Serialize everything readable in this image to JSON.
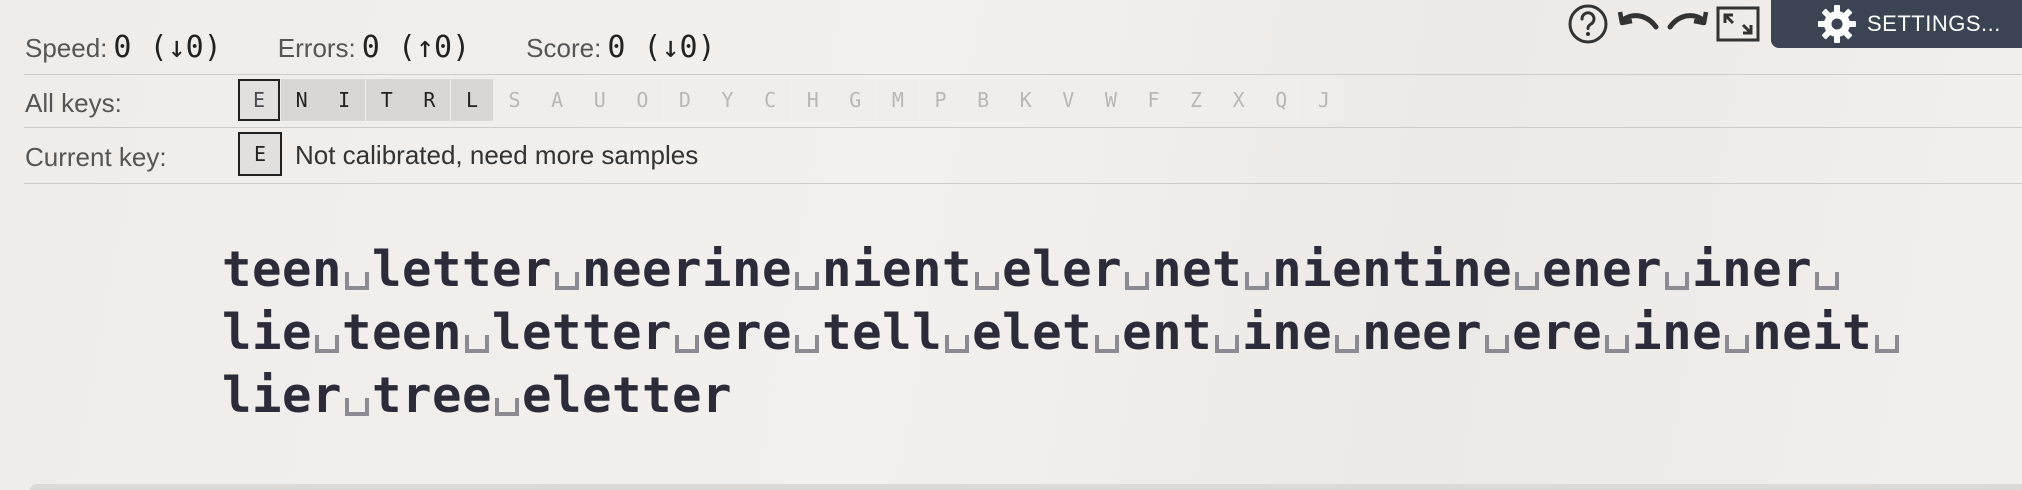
{
  "toolbar": {
    "help_icon": "help-icon",
    "undo_icon": "undo-icon",
    "redo_icon": "redo-icon",
    "fullscreen_icon": "fullscreen-icon",
    "settings_label": "SETTINGS..."
  },
  "stats": {
    "speed_label": "Speed:",
    "speed_value": "0 (↓0)",
    "errors_label": "Errors:",
    "errors_value": "0 (↑0)",
    "score_label": "Score:",
    "score_value": "0 (↓0)"
  },
  "all_keys": {
    "label": "All keys:",
    "keys": [
      {
        "k": "E",
        "state": "selected"
      },
      {
        "k": "N",
        "state": "on"
      },
      {
        "k": "I",
        "state": "on"
      },
      {
        "k": "T",
        "state": "on"
      },
      {
        "k": "R",
        "state": "on"
      },
      {
        "k": "L",
        "state": "on"
      },
      {
        "k": "S",
        "state": "off"
      },
      {
        "k": "A",
        "state": "off"
      },
      {
        "k": "U",
        "state": "off"
      },
      {
        "k": "O",
        "state": "off"
      },
      {
        "k": "D",
        "state": "off"
      },
      {
        "k": "Y",
        "state": "off"
      },
      {
        "k": "C",
        "state": "off"
      },
      {
        "k": "H",
        "state": "off"
      },
      {
        "k": "G",
        "state": "off"
      },
      {
        "k": "M",
        "state": "off"
      },
      {
        "k": "P",
        "state": "off"
      },
      {
        "k": "B",
        "state": "off"
      },
      {
        "k": "K",
        "state": "off"
      },
      {
        "k": "V",
        "state": "off"
      },
      {
        "k": "W",
        "state": "off"
      },
      {
        "k": "F",
        "state": "off"
      },
      {
        "k": "Z",
        "state": "off"
      },
      {
        "k": "X",
        "state": "off"
      },
      {
        "k": "Q",
        "state": "off"
      },
      {
        "k": "J",
        "state": "off"
      }
    ]
  },
  "current_key": {
    "label": "Current key:",
    "key": "E",
    "status": "Not calibrated, need more samples"
  },
  "lesson": {
    "lines": [
      [
        "teen",
        "letter",
        "neerine",
        "nient",
        "eler",
        "net",
        "nientine",
        "ener",
        "iner",
        ""
      ],
      [
        "lie",
        "teen",
        "letter",
        "ere",
        "tell",
        "elet",
        "ent",
        "ine",
        "neer",
        "ere",
        "ine",
        "neit",
        ""
      ],
      [
        "lier",
        "tree",
        "eletter"
      ]
    ]
  },
  "colors": {
    "settings_bg": "#3a4452",
    "key_on": "#d9d7d6",
    "key_off": "#f0eeec",
    "text_dark": "#2b2b3a"
  }
}
